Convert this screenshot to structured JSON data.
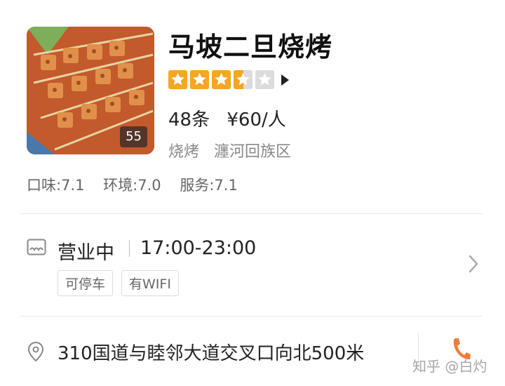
{
  "shop": {
    "name": "马坡二旦烧烤",
    "photo_count": "55",
    "rating_stars": 3.5,
    "review_count": "48条",
    "avg_price": "¥60/人",
    "category": "烧烤",
    "district": "瀍河回族区"
  },
  "scores": {
    "taste": "口味:7.1",
    "environment": "环境:7.0",
    "service": "服务:7.1"
  },
  "business": {
    "status": "营业中",
    "hours": "17:00-23:00",
    "tags": [
      "可停车",
      "有WIFI"
    ]
  },
  "location": {
    "address": "310国道与睦邻大道交叉口向北500米"
  },
  "watermark": "知乎 @白灼",
  "colors": {
    "star_filled": "#f5a623",
    "star_empty": "#dcdcdc",
    "phone": "#f07c3a"
  },
  "icons": [
    "storefront-icon",
    "chevron-right-icon",
    "location-pin-icon",
    "phone-icon",
    "star-icon",
    "play-arrow-icon"
  ]
}
